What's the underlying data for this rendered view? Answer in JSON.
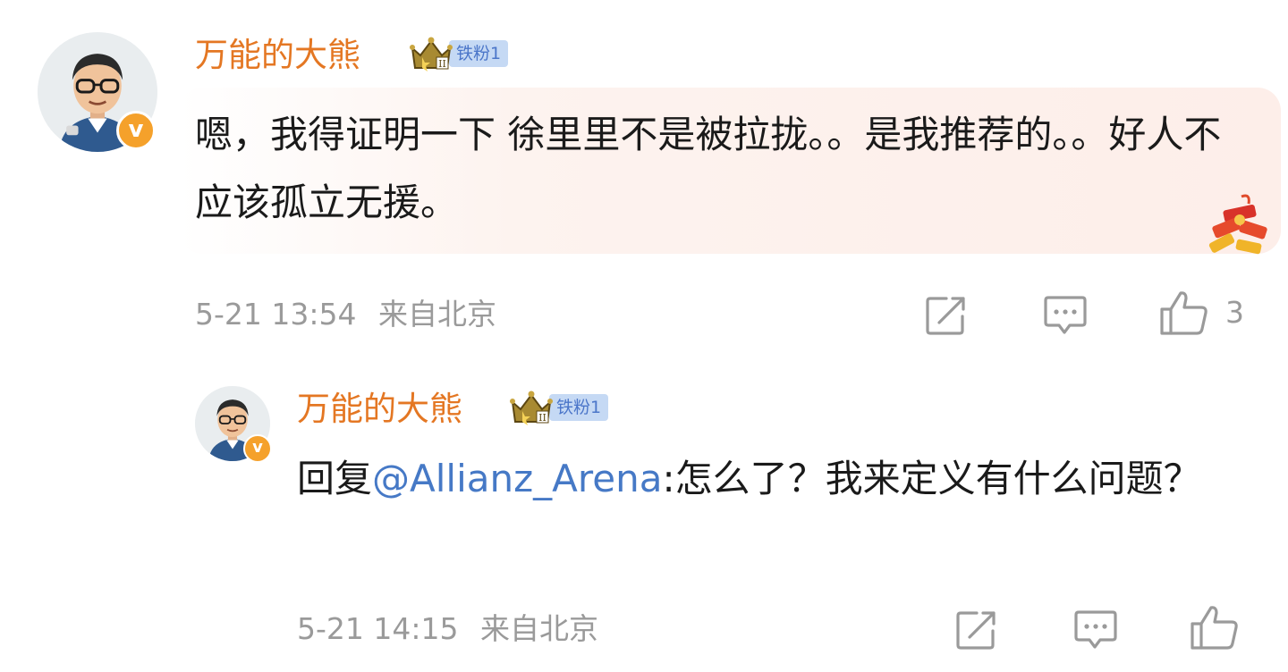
{
  "comments": [
    {
      "author": "万能的大熊",
      "fan_badge": "铁粉1",
      "crown_level": "II",
      "verified_badge": "v",
      "text": "嗯，我得证明一下 徐里里不是被拉拢。。是我推荐的。。好人不应该孤立无援。",
      "time": "5-21 13:54",
      "location": "来自北京",
      "like_count": "3",
      "icons": [
        "share-icon",
        "comment-icon",
        "like-icon",
        "firecracker-icon"
      ]
    },
    {
      "author": "万能的大熊",
      "fan_badge": "铁粉1",
      "crown_level": "II",
      "verified_badge": "v",
      "reply_prefix": "回复",
      "mention": "@Allianz_Arena",
      "text": ":怎么了？我来定义有什么问题？",
      "time": "5-21 14:15",
      "location": "来自北京",
      "icons": [
        "share-icon",
        "comment-icon",
        "like-icon"
      ]
    }
  ],
  "colors": {
    "author": "#e47723",
    "mention": "#4679c6",
    "meta": "#9a9a9a",
    "text": "#1a1a1a",
    "fan_chip_bg": "#c5d9f4",
    "fan_chip_text": "#4b76c9",
    "verified": "#f5a12b"
  }
}
